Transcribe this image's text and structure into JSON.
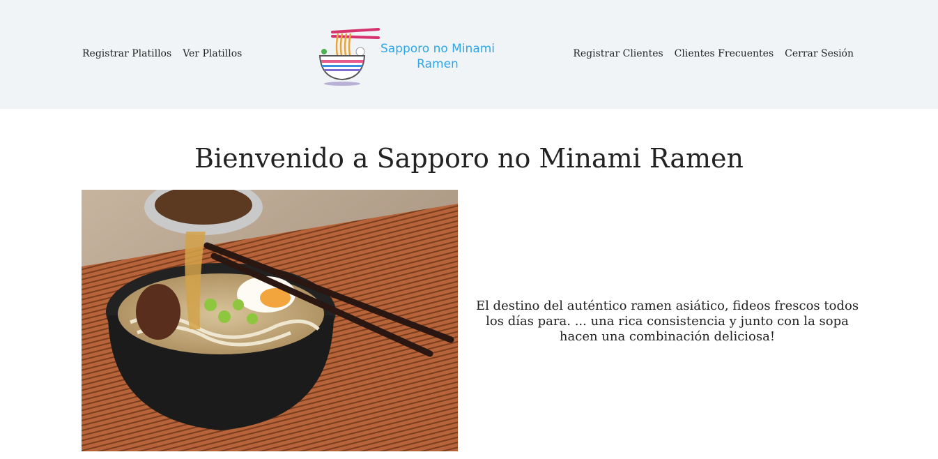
{
  "nav": {
    "left": [
      "Registrar Platillos",
      "Ver Platillos"
    ],
    "right": [
      "Registrar Clientes",
      "Clientes Frecuentes",
      "Cerrar Sesión"
    ]
  },
  "logo": {
    "line1": "Sapporo no Minami",
    "line2": "Ramen",
    "icon": "ramen-bowl-icon",
    "color": "#2fa6e8"
  },
  "main": {
    "title": "Bienvenido a Sapporo no Minami Ramen",
    "tagline": "El destino del auténtico ramen asiático, fideos frescos todos los días para. ... una rica consistencia y junto con la sopa hacen una combinación deliciosa!"
  },
  "colors": {
    "header_bg": "#f0f4f7",
    "text": "#222222"
  }
}
